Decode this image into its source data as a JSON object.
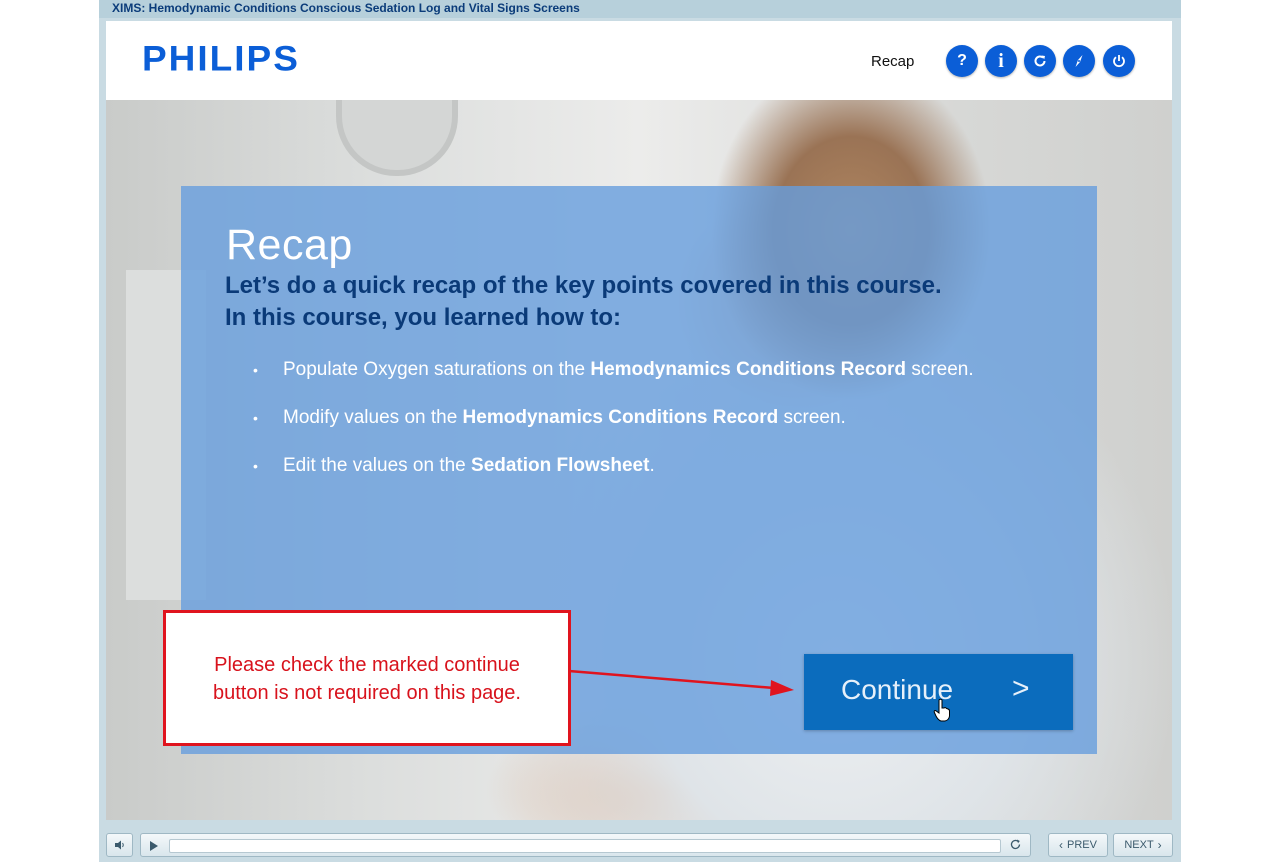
{
  "window": {
    "title": "XIMS: Hemodynamic Conditions Conscious Sedation Log and Vital Signs Screens"
  },
  "header": {
    "logo": "PHILIPS",
    "section_label": "Recap",
    "buttons": [
      {
        "icon": "help-icon",
        "glyph": "?"
      },
      {
        "icon": "info-icon",
        "glyph": "i"
      },
      {
        "icon": "replay-icon"
      },
      {
        "icon": "compass-icon"
      },
      {
        "icon": "power-icon"
      }
    ]
  },
  "content": {
    "title": "Recap",
    "subhead_1": "Let’s do a quick recap of the key points covered in this course.",
    "subhead_2": "In this course, you learned how to:",
    "bullets": [
      {
        "pre": "Populate Oxygen saturations on the ",
        "bold": "Hemodynamics Conditions Record",
        "post": " screen."
      },
      {
        "pre": "Modify values on the ",
        "bold": "Hemodynamics Conditions Record",
        "post": " screen."
      },
      {
        "pre": "Edit the values on the ",
        "bold": "Sedation Flowsheet",
        "post": "."
      }
    ],
    "continue_label": "Continue",
    "continue_arrow": ">"
  },
  "annotation": {
    "note_line_1": "Please check the marked continue",
    "note_line_2": "button is not required on this page.",
    "color": "#e0141e"
  },
  "player": {
    "prev_label": "PREV",
    "next_label": "NEXT",
    "progress": 0.0
  },
  "colors": {
    "brand_blue": "#0b5ed7",
    "panel_blue": "#669edd",
    "continue_blue": "#0b6cbd",
    "subhead_navy": "#0a3a78"
  }
}
